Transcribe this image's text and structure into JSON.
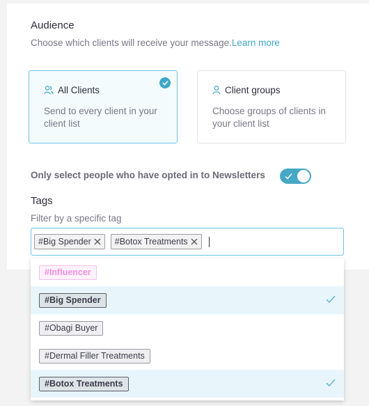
{
  "audience": {
    "title": "Audience",
    "subtitle": "Choose which clients will receive your message.",
    "learn_more": "Learn more",
    "options": [
      {
        "label": "All Clients",
        "description": "Send to every client in your client list",
        "selected": true
      },
      {
        "label": "Client groups",
        "description": "Choose groups of clients in your client list",
        "selected": false
      }
    ]
  },
  "newsletter": {
    "label": "Only select people who have opted in to Newsletters",
    "enabled": true
  },
  "tags": {
    "title": "Tags",
    "subtitle": "Filter by a specific tag",
    "selected": [
      "#Big Spender",
      "#Botox Treatments"
    ],
    "options": [
      {
        "label": "#Influencer",
        "selected": false
      },
      {
        "label": "#Big Spender",
        "selected": true
      },
      {
        "label": "#Obagi Buyer",
        "selected": false
      },
      {
        "label": "#Dermal Filler Treatments",
        "selected": false
      },
      {
        "label": "#Botox Treatments",
        "selected": true
      }
    ]
  },
  "colors": {
    "accent": "#3fa7c9",
    "toggle": "#47a8c6",
    "selected_row": "#e8f6fb",
    "influencer_tag": "#f08fdc"
  }
}
